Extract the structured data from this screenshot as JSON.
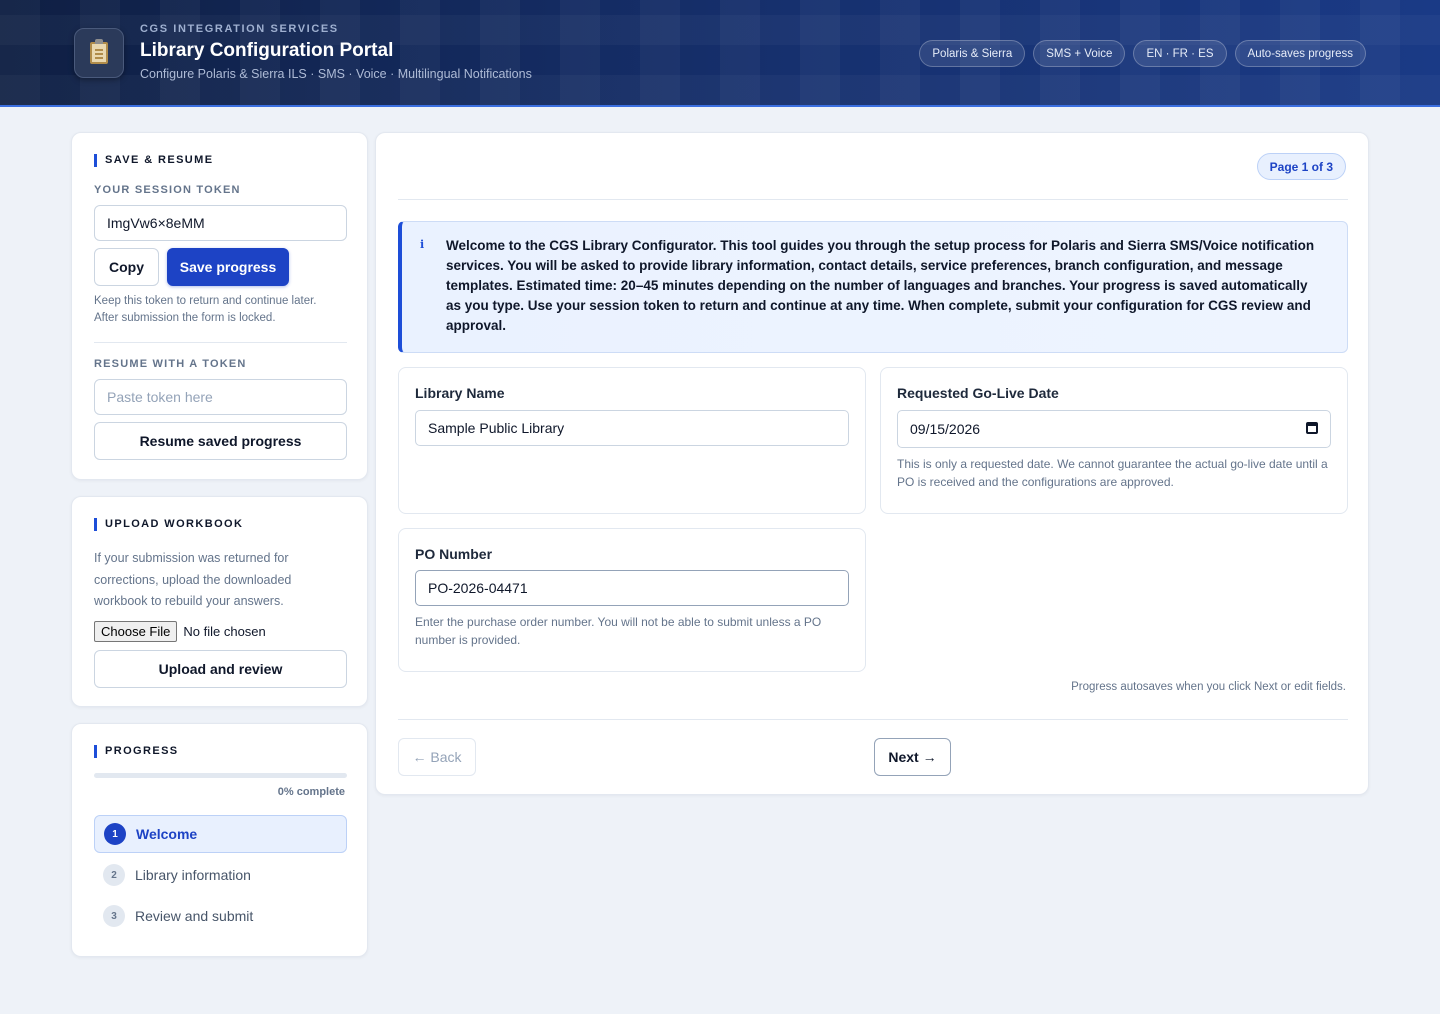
{
  "header": {
    "eyebrow": "CGS INTEGRATION SERVICES",
    "title": "Library Configuration Portal",
    "subtitle": "Configure Polaris & Sierra ILS · SMS · Voice · Multilingual Notifications",
    "logo_icon": "clipboard-icon",
    "pills": [
      "Polaris & Sierra",
      "SMS + Voice",
      "EN · FR · ES",
      "Auto-saves progress"
    ]
  },
  "save_resume": {
    "title": "SAVE & RESUME",
    "token_label": "YOUR SESSION TOKEN",
    "token_value": "ImgVw6×8eMM",
    "copy_label": "Copy",
    "save_label": "Save progress",
    "help_line1": "Keep this token to return and continue later.",
    "help_line2": "After submission the form is locked.",
    "resume_label": "RESUME WITH A TOKEN",
    "resume_placeholder": "Paste token here",
    "resume_button": "Resume saved progress"
  },
  "upload": {
    "title": "UPLOAD WORKBOOK",
    "help": "If your submission was returned for corrections, upload the downloaded workbook to rebuild your answers.",
    "choose_label": "Choose File",
    "no_file": "No file chosen",
    "upload_button": "Upload and review"
  },
  "progress": {
    "title": "PROGRESS",
    "percent_value": 0,
    "percent_text": "0% complete",
    "steps": [
      {
        "num": "1",
        "label": "Welcome",
        "active": true
      },
      {
        "num": "2",
        "label": "Library information",
        "active": false
      },
      {
        "num": "3",
        "label": "Review and submit",
        "active": false
      }
    ]
  },
  "main": {
    "page_badge": "Page 1 of 3",
    "info_icon": "info-icon",
    "info_glyph": "i",
    "info_text": "Welcome to the CGS Library Configurator. This tool guides you through the setup process for Polaris and Sierra SMS/Voice notification services. You will be asked to provide library information, contact details, service preferences, branch configuration, and message templates. Estimated time: 20–45 minutes depending on the number of languages and branches. Your progress is saved automatically as you type. Use your session token to return and continue at any time. When complete, submit your configuration for CGS review and approval.",
    "library_name_label": "Library Name",
    "library_name_value": "Sample Public Library",
    "golive_label": "Requested Go-Live Date",
    "golive_value": "09/15/2026",
    "golive_help": "This is only a requested date. We cannot guarantee the actual go-live date until a PO is received and the configurations are approved.",
    "po_label": "PO Number",
    "po_value": "PO-2026-04471",
    "po_help": "Enter the purchase order number. You will not be able to submit unless a PO number is provided.",
    "autosave_note": "Progress autosaves when you click Next or edit fields.",
    "back_label": "← Back",
    "next_label": "Next →"
  }
}
